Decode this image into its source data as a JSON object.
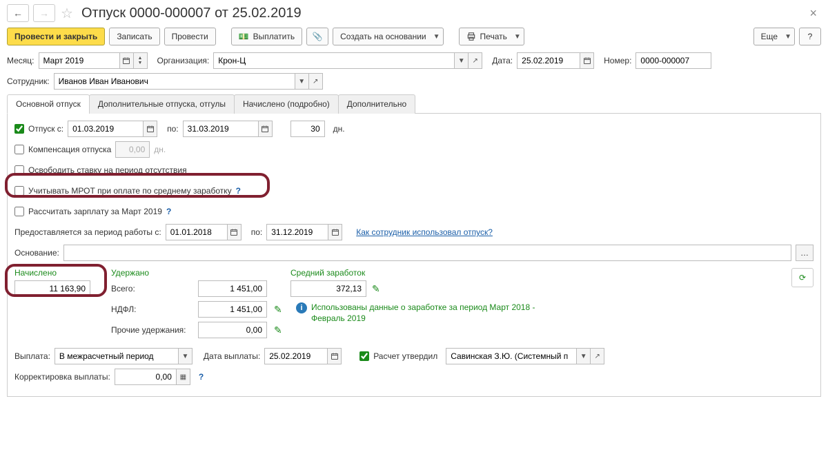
{
  "header": {
    "title": "Отпуск 0000-000007 от 25.02.2019"
  },
  "toolbar": {
    "post_and_close": "Провести и закрыть",
    "save": "Записать",
    "post": "Провести",
    "pay": "Выплатить",
    "create_based": "Создать на основании",
    "print": "Печать",
    "more": "Еще",
    "help": "?"
  },
  "top_form": {
    "month_label": "Месяц:",
    "month_value": "Март 2019",
    "org_label": "Организация:",
    "org_value": "Крон-Ц",
    "date_label": "Дата:",
    "date_value": "25.02.2019",
    "number_label": "Номер:",
    "number_value": "0000-000007",
    "employee_label": "Сотрудник:",
    "employee_value": "Иванов Иван Иванович"
  },
  "tabs": {
    "t1": "Основной отпуск",
    "t2": "Дополнительные отпуска, отгулы",
    "t3": "Начислено (подробно)",
    "t4": "Дополнительно"
  },
  "main_tab": {
    "vac_check": true,
    "vac_label": "Отпуск  с:",
    "vac_from": "01.03.2019",
    "vac_to_label": "по:",
    "vac_to": "31.03.2019",
    "vac_days": "30",
    "vac_days_unit": "дн.",
    "comp_label": "Компенсация отпуска",
    "comp_value": "0,00",
    "comp_unit": "дн.",
    "release_label": "Освободить ставку на период отсутствия",
    "mrot_label": "Учитывать МРОТ при оплате по среднему заработку",
    "recalc_label": "Рассчитать зарплату за Март 2019",
    "period_label": "Предоставляется за период работы с:",
    "period_from": "01.01.2018",
    "period_to_label": "по:",
    "period_to": "31.12.2019",
    "how_used_link": "Как сотрудник использовал отпуск?",
    "basis_label": "Основание:"
  },
  "totals": {
    "accrued_head": "Начислено",
    "accrued_value": "11 163,90",
    "deducted_head": "Удержано",
    "total_label": "Всего:",
    "total_value": "1 451,00",
    "ndfl_label": "НДФЛ:",
    "ndfl_value": "1 451,00",
    "other_label": "Прочие удержания:",
    "other_value": "0,00",
    "avg_head": "Средний заработок",
    "avg_value": "372,13",
    "note": "Использованы данные о заработке за период Март 2018 - Февраль 2019"
  },
  "footer": {
    "payout_label": "Выплата:",
    "payout_value": "В межрасчетный период",
    "payout_date_label": "Дата выплаты:",
    "payout_date_value": "25.02.2019",
    "approved_label": "Расчет утвердил",
    "approver_value": "Савинская З.Ю. (Системный п",
    "corr_label": "Корректировка выплаты:",
    "corr_value": "0,00"
  }
}
